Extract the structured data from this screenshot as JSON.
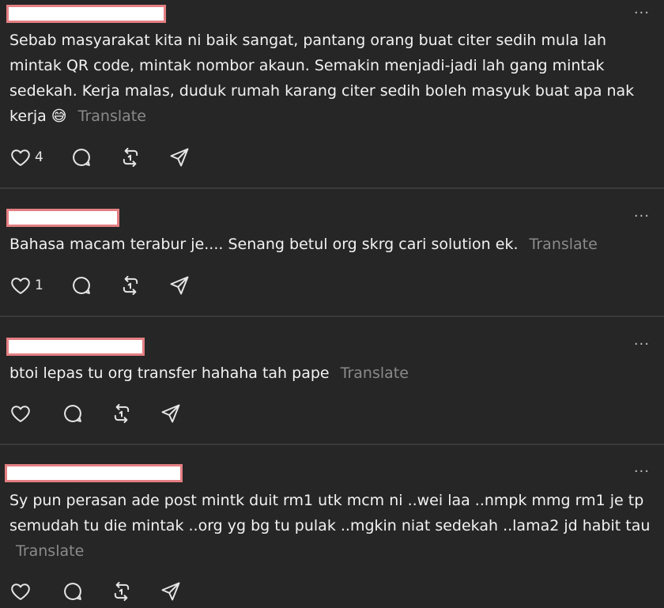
{
  "posts": [
    {
      "text": "Sebab masyarakat kita ni baik sangat, pantang orang buat citer sedih mula lah mintak QR code, mintak nombor akaun. Semakin menjadi-jadi lah gang mintak sedekah. Kerja malas, duduk rumah karang citer sedih boleh masyuk buat apa nak kerja",
      "emoji": "😅",
      "translate_label": "Translate",
      "likes": "4"
    },
    {
      "text": "Bahasa macam terabur je.... Senang betul org skrg cari solution ek.",
      "translate_label": "Translate",
      "likes": "1"
    },
    {
      "text": "btoi lepas tu org transfer hahaha tah pape",
      "translate_label": "Translate",
      "likes": ""
    },
    {
      "text": "Sy pun perasan ade post mintk duit rm1 utk mcm ni ..wei laa ..nmpk mmg rm1 je tp semudah tu die mintak ..org yg bg tu pulak ..mgkin niat sedekah ..lama2 jd habit tau",
      "translate_label": "Translate",
      "likes": ""
    }
  ],
  "more_glyph": "···",
  "icons": [
    "heart-icon",
    "reply-icon",
    "repost-icon",
    "share-icon"
  ]
}
